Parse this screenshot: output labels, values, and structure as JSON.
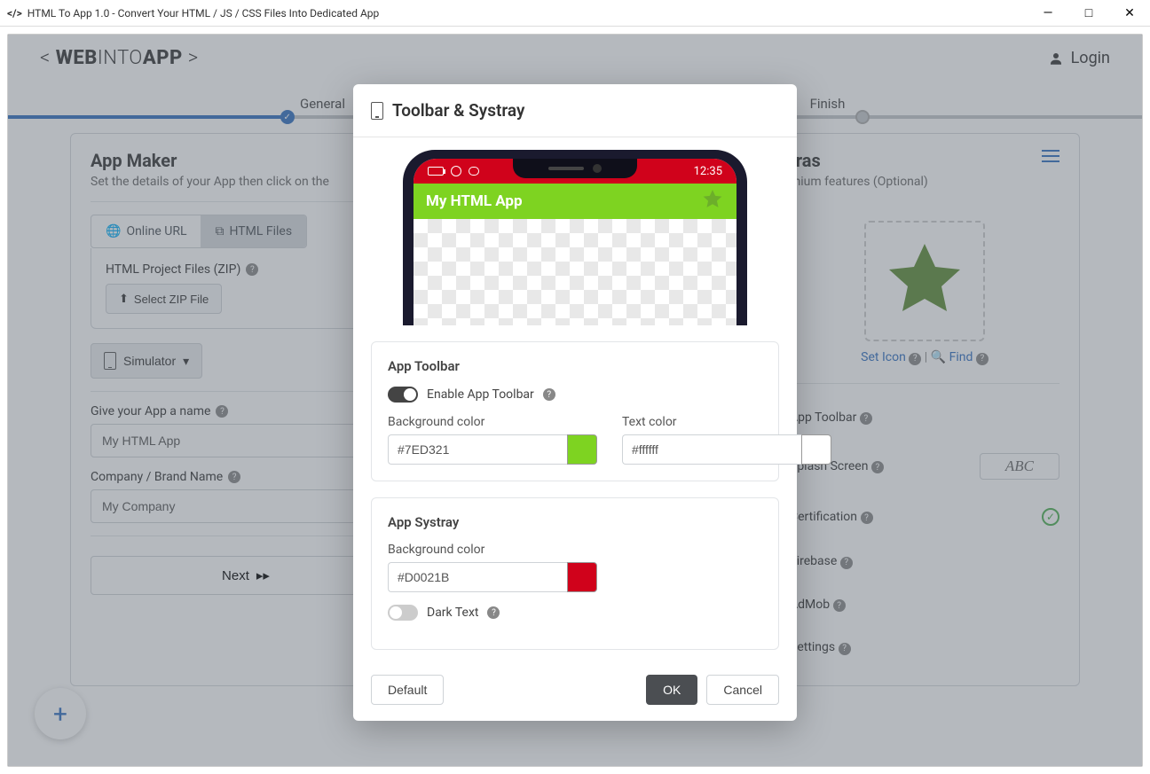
{
  "window": {
    "title": "HTML To App 1.0 - Convert Your HTML / JS / CSS Files Into Dedicated App",
    "minimize": "—",
    "maximize": "□",
    "close": "✕"
  },
  "brand": {
    "left_chevron": "<",
    "pre": "WEB",
    "mid": "INTO",
    "post": "APP",
    "right_chevron": ">"
  },
  "login": "Login",
  "wizard": {
    "step1": "General",
    "step2": "Finish"
  },
  "appmaker": {
    "title": "App Maker",
    "subtitle": "Set the details of your App then click on the",
    "tab_online": "Online URL",
    "tab_html": "HTML Files",
    "zip_label": "HTML Project Files (ZIP)",
    "select_zip": "Select ZIP File",
    "simulator": "Simulator",
    "name_label": "Give your App a name",
    "name_value": "My HTML App",
    "company_label": "Company / Brand Name",
    "company_value": "My Company",
    "next": "Next"
  },
  "extras": {
    "title_suffix": "tras",
    "subtitle_suffix": "mium features (Optional)",
    "set_icon": "Set Icon",
    "find": "Find",
    "app_toolbar": "App Toolbar",
    "splash_screen": "Splash Screen",
    "abc": "ABC",
    "certification": "Certification",
    "firebase": "Firebase",
    "admob": "AdMob",
    "settings": "Settings"
  },
  "modal": {
    "title": "Toolbar & Systray",
    "phone": {
      "time": "12:35",
      "app_name": "My HTML App"
    },
    "card1": {
      "title": "App Toolbar",
      "enable": "Enable App Toolbar",
      "bg_label": "Background color",
      "bg_value": "#7ED321",
      "text_label": "Text color",
      "text_value": "#ffffff"
    },
    "card2": {
      "title": "App Systray",
      "bg_label": "Background color",
      "bg_value": "#D0021B",
      "dark_text": "Dark Text"
    },
    "default": "Default",
    "ok": "OK",
    "cancel": "Cancel"
  },
  "fab": "+"
}
